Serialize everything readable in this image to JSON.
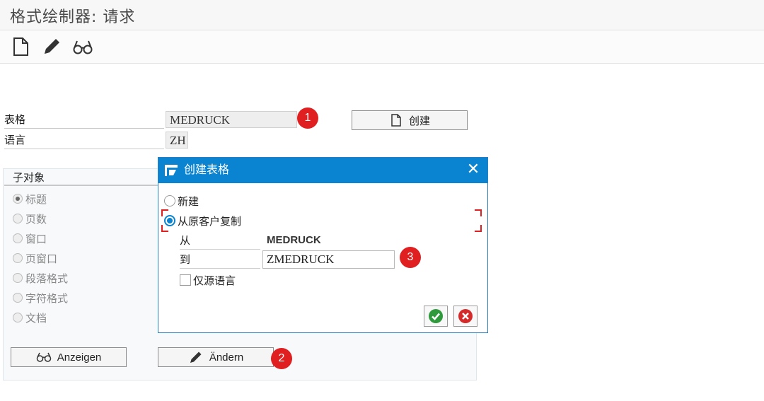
{
  "window": {
    "title": "格式绘制器: 请求"
  },
  "toolbar": {
    "icons": [
      "new-document-icon",
      "pencil-icon",
      "glasses-icon"
    ]
  },
  "form": {
    "fields": [
      {
        "label": "表格",
        "value": "MEDRUCK",
        "badge": "1"
      },
      {
        "label": "语言",
        "value": "ZH"
      }
    ],
    "create_button": "创建"
  },
  "subobjects": {
    "header": "子对象",
    "options": [
      "标题",
      "页数",
      "窗口",
      "页窗口",
      "段落格式",
      "字符格式",
      "文档"
    ],
    "selected": "标题"
  },
  "buttons": {
    "display": "Anzeigen",
    "change": "Ändern",
    "change_badge": "2"
  },
  "dialog": {
    "title": "创建表格",
    "options": [
      "新建",
      "从原客户复制"
    ],
    "selected": "从原客户复制",
    "from_label": "从",
    "from_value": "MEDRUCK",
    "to_label": "到",
    "to_value": "ZMEDRUCK",
    "to_badge": "3",
    "checkbox_label": "仅源语言",
    "checkbox_checked": false,
    "close": "✕",
    "colors": {
      "header": "#0a83d0",
      "confirm": "#2e9a3c",
      "cancel": "#d42a2a",
      "badge": "#e02020"
    }
  }
}
